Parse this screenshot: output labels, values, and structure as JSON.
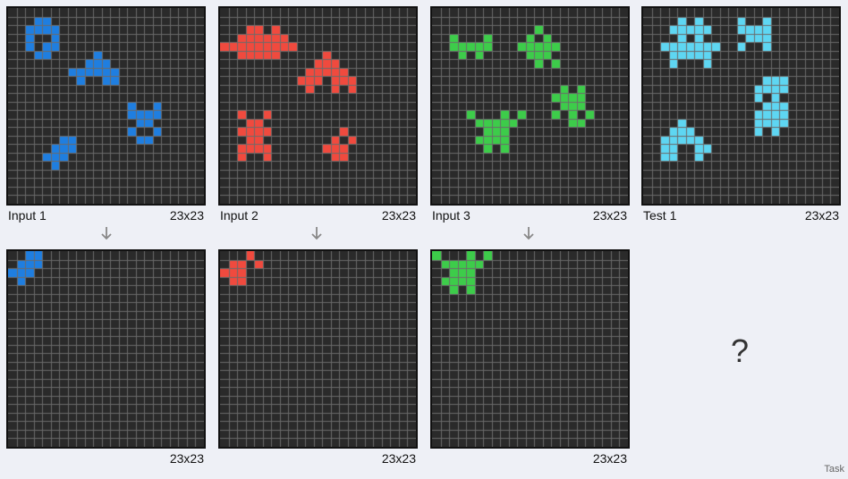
{
  "palette": {
    "blue": "#1f7ee0",
    "red": "#f04a3e",
    "green": "#3dcc4a",
    "cyan": "#5ed6f2",
    "cell_bg": "#2a2a2a",
    "grid_line": "#6b6b6b"
  },
  "pairs": [
    {
      "input": {
        "label": "Input 1",
        "size": "23x23",
        "color": "blue",
        "cells": [
          [
            1,
            3
          ],
          [
            1,
            4
          ],
          [
            2,
            2
          ],
          [
            2,
            3
          ],
          [
            2,
            4
          ],
          [
            2,
            5
          ],
          [
            3,
            2
          ],
          [
            3,
            5
          ],
          [
            4,
            2
          ],
          [
            4,
            4
          ],
          [
            4,
            5
          ],
          [
            5,
            3
          ],
          [
            5,
            4
          ],
          [
            5,
            10
          ],
          [
            6,
            9
          ],
          [
            6,
            10
          ],
          [
            6,
            11
          ],
          [
            7,
            7
          ],
          [
            7,
            8
          ],
          [
            7,
            9
          ],
          [
            7,
            10
          ],
          [
            7,
            11
          ],
          [
            7,
            12
          ],
          [
            8,
            8
          ],
          [
            8,
            11
          ],
          [
            8,
            12
          ],
          [
            11,
            14
          ],
          [
            11,
            17
          ],
          [
            12,
            14
          ],
          [
            12,
            15
          ],
          [
            12,
            16
          ],
          [
            12,
            17
          ],
          [
            13,
            15
          ],
          [
            13,
            16
          ],
          [
            14,
            14
          ],
          [
            14,
            17
          ],
          [
            15,
            15
          ],
          [
            15,
            16
          ],
          [
            15,
            6
          ],
          [
            15,
            7
          ],
          [
            16,
            5
          ],
          [
            16,
            6
          ],
          [
            16,
            7
          ],
          [
            17,
            4
          ],
          [
            17,
            5
          ],
          [
            17,
            6
          ],
          [
            18,
            5
          ]
        ]
      },
      "output": {
        "label": "",
        "size": "23x23",
        "color": "blue",
        "cells": [
          [
            0,
            2
          ],
          [
            0,
            3
          ],
          [
            1,
            1
          ],
          [
            1,
            2
          ],
          [
            1,
            3
          ],
          [
            2,
            0
          ],
          [
            2,
            1
          ],
          [
            2,
            2
          ],
          [
            3,
            1
          ]
        ]
      }
    },
    {
      "input": {
        "label": "Input 2",
        "size": "23x23",
        "color": "red",
        "cells": [
          [
            2,
            3
          ],
          [
            2,
            4
          ],
          [
            2,
            6
          ],
          [
            3,
            2
          ],
          [
            3,
            3
          ],
          [
            3,
            4
          ],
          [
            3,
            5
          ],
          [
            3,
            6
          ],
          [
            3,
            7
          ],
          [
            4,
            0
          ],
          [
            4,
            1
          ],
          [
            4,
            2
          ],
          [
            4,
            3
          ],
          [
            4,
            4
          ],
          [
            4,
            5
          ],
          [
            4,
            6
          ],
          [
            4,
            7
          ],
          [
            4,
            8
          ],
          [
            5,
            2
          ],
          [
            5,
            3
          ],
          [
            5,
            4
          ],
          [
            5,
            5
          ],
          [
            5,
            6
          ],
          [
            5,
            12
          ],
          [
            6,
            11
          ],
          [
            6,
            12
          ],
          [
            6,
            13
          ],
          [
            7,
            10
          ],
          [
            7,
            11
          ],
          [
            7,
            12
          ],
          [
            7,
            13
          ],
          [
            7,
            14
          ],
          [
            8,
            9
          ],
          [
            8,
            10
          ],
          [
            8,
            11
          ],
          [
            8,
            13
          ],
          [
            8,
            14
          ],
          [
            8,
            15
          ],
          [
            9,
            10
          ],
          [
            9,
            13
          ],
          [
            9,
            15
          ],
          [
            12,
            2
          ],
          [
            12,
            5
          ],
          [
            13,
            3
          ],
          [
            13,
            4
          ],
          [
            14,
            2
          ],
          [
            14,
            3
          ],
          [
            14,
            4
          ],
          [
            14,
            5
          ],
          [
            15,
            3
          ],
          [
            15,
            4
          ],
          [
            16,
            2
          ],
          [
            16,
            3
          ],
          [
            16,
            4
          ],
          [
            16,
            5
          ],
          [
            17,
            2
          ],
          [
            17,
            5
          ],
          [
            14,
            14
          ],
          [
            15,
            13
          ],
          [
            15,
            15
          ],
          [
            16,
            12
          ],
          [
            16,
            13
          ],
          [
            16,
            14
          ],
          [
            17,
            13
          ],
          [
            17,
            14
          ]
        ]
      },
      "output": {
        "label": "",
        "size": "23x23",
        "color": "red",
        "cells": [
          [
            0,
            3
          ],
          [
            1,
            1
          ],
          [
            1,
            2
          ],
          [
            1,
            4
          ],
          [
            2,
            0
          ],
          [
            2,
            1
          ],
          [
            2,
            2
          ],
          [
            3,
            1
          ],
          [
            3,
            2
          ]
        ]
      }
    },
    {
      "input": {
        "label": "Input 3",
        "size": "23x23",
        "color": "green",
        "cells": [
          [
            3,
            2
          ],
          [
            3,
            6
          ],
          [
            4,
            2
          ],
          [
            4,
            3
          ],
          [
            4,
            4
          ],
          [
            4,
            5
          ],
          [
            4,
            6
          ],
          [
            5,
            3
          ],
          [
            5,
            5
          ],
          [
            2,
            12
          ],
          [
            3,
            11
          ],
          [
            3,
            13
          ],
          [
            4,
            10
          ],
          [
            4,
            11
          ],
          [
            4,
            12
          ],
          [
            4,
            13
          ],
          [
            4,
            14
          ],
          [
            5,
            11
          ],
          [
            5,
            12
          ],
          [
            5,
            13
          ],
          [
            6,
            12
          ],
          [
            6,
            14
          ],
          [
            9,
            15
          ],
          [
            9,
            17
          ],
          [
            10,
            14
          ],
          [
            10,
            15
          ],
          [
            10,
            16
          ],
          [
            10,
            17
          ],
          [
            11,
            15
          ],
          [
            11,
            16
          ],
          [
            11,
            17
          ],
          [
            12,
            14
          ],
          [
            12,
            16
          ],
          [
            12,
            18
          ],
          [
            13,
            16
          ],
          [
            13,
            17
          ],
          [
            12,
            4
          ],
          [
            12,
            8
          ],
          [
            12,
            10
          ],
          [
            13,
            5
          ],
          [
            13,
            6
          ],
          [
            13,
            7
          ],
          [
            13,
            8
          ],
          [
            13,
            9
          ],
          [
            14,
            6
          ],
          [
            14,
            7
          ],
          [
            14,
            8
          ],
          [
            15,
            5
          ],
          [
            15,
            6
          ],
          [
            15,
            7
          ],
          [
            15,
            8
          ],
          [
            16,
            6
          ],
          [
            16,
            8
          ]
        ]
      },
      "output": {
        "label": "",
        "size": "23x23",
        "color": "green",
        "cells": [
          [
            0,
            0
          ],
          [
            0,
            4
          ],
          [
            0,
            6
          ],
          [
            1,
            1
          ],
          [
            1,
            2
          ],
          [
            1,
            3
          ],
          [
            1,
            4
          ],
          [
            1,
            5
          ],
          [
            2,
            2
          ],
          [
            2,
            3
          ],
          [
            2,
            4
          ],
          [
            3,
            1
          ],
          [
            3,
            2
          ],
          [
            3,
            3
          ],
          [
            3,
            4
          ],
          [
            4,
            2
          ],
          [
            4,
            4
          ]
        ]
      }
    }
  ],
  "test": {
    "label": "Test 1",
    "size": "23x23",
    "color": "cyan",
    "cells": [
      [
        1,
        4
      ],
      [
        1,
        6
      ],
      [
        2,
        3
      ],
      [
        2,
        4
      ],
      [
        2,
        5
      ],
      [
        2,
        6
      ],
      [
        2,
        7
      ],
      [
        3,
        4
      ],
      [
        3,
        6
      ],
      [
        4,
        2
      ],
      [
        4,
        3
      ],
      [
        4,
        4
      ],
      [
        4,
        5
      ],
      [
        4,
        6
      ],
      [
        4,
        7
      ],
      [
        4,
        8
      ],
      [
        5,
        3
      ],
      [
        5,
        4
      ],
      [
        5,
        5
      ],
      [
        5,
        6
      ],
      [
        5,
        7
      ],
      [
        6,
        3
      ],
      [
        6,
        7
      ],
      [
        1,
        11
      ],
      [
        1,
        14
      ],
      [
        2,
        11
      ],
      [
        2,
        12
      ],
      [
        2,
        13
      ],
      [
        2,
        14
      ],
      [
        3,
        12
      ],
      [
        3,
        13
      ],
      [
        3,
        14
      ],
      [
        4,
        11
      ],
      [
        4,
        14
      ],
      [
        8,
        14
      ],
      [
        8,
        15
      ],
      [
        8,
        16
      ],
      [
        9,
        13
      ],
      [
        9,
        14
      ],
      [
        9,
        15
      ],
      [
        9,
        16
      ],
      [
        10,
        13
      ],
      [
        10,
        15
      ],
      [
        11,
        14
      ],
      [
        11,
        15
      ],
      [
        11,
        16
      ],
      [
        12,
        13
      ],
      [
        12,
        14
      ],
      [
        12,
        15
      ],
      [
        12,
        16
      ],
      [
        13,
        13
      ],
      [
        13,
        14
      ],
      [
        13,
        15
      ],
      [
        13,
        16
      ],
      [
        14,
        13
      ],
      [
        14,
        15
      ],
      [
        13,
        4
      ],
      [
        14,
        3
      ],
      [
        14,
        4
      ],
      [
        14,
        5
      ],
      [
        15,
        2
      ],
      [
        15,
        3
      ],
      [
        15,
        4
      ],
      [
        15,
        5
      ],
      [
        15,
        6
      ],
      [
        16,
        2
      ],
      [
        16,
        3
      ],
      [
        16,
        6
      ],
      [
        16,
        7
      ],
      [
        17,
        2
      ],
      [
        17,
        3
      ],
      [
        17,
        6
      ]
    ]
  },
  "test_output_placeholder": "?",
  "footer_label": "Task"
}
